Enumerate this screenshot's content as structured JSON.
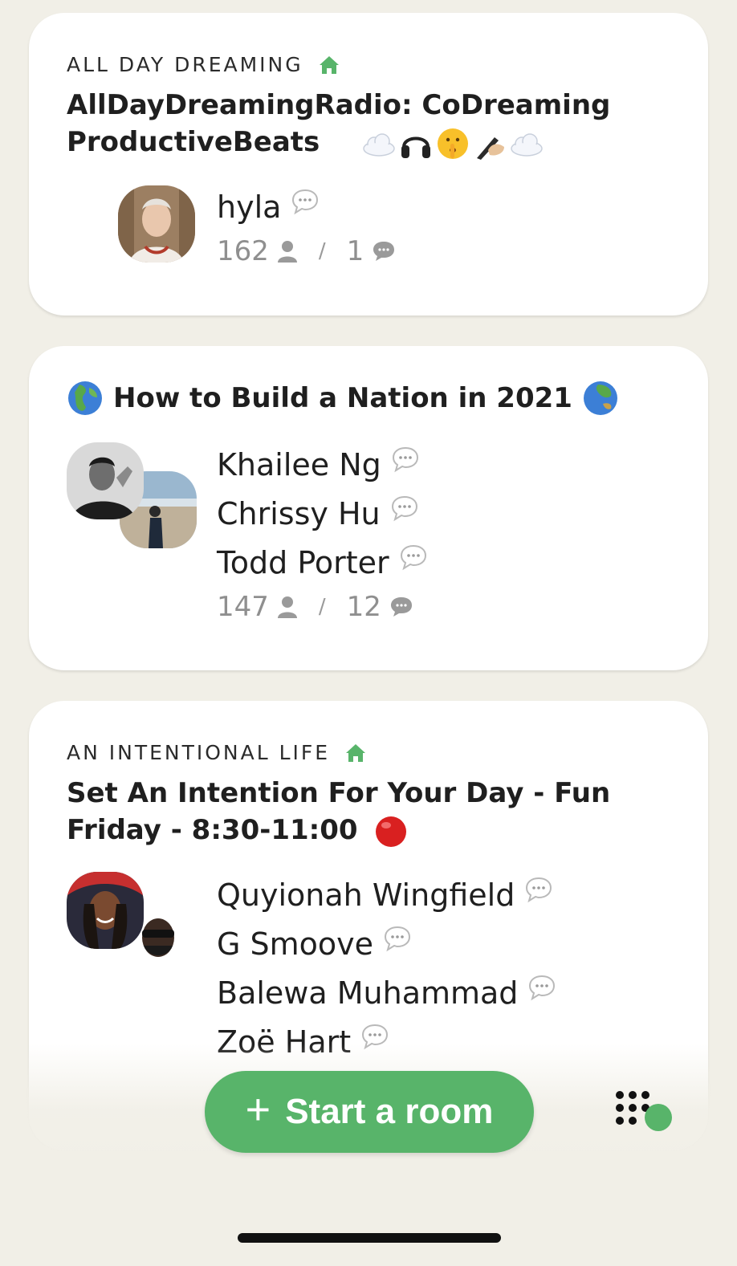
{
  "rooms": [
    {
      "club": "ALL DAY DREAMING",
      "title": "AllDayDreamingRadio: CoDreaming ProductiveBeats",
      "title_emoji": [
        "cloud",
        "headphones",
        "shushing-face",
        "writing-hand",
        "cloud"
      ],
      "speakers": [
        "hyla"
      ],
      "listeners": "162",
      "speaker_count": "1"
    },
    {
      "club": "",
      "title": "How to Build a Nation in 2021",
      "title_emoji": [
        "globe-europe-africa",
        "globe-asia-australia"
      ],
      "speakers": [
        "Khailee Ng",
        "Chrissy Hu",
        "Todd Porter"
      ],
      "listeners": "147",
      "speaker_count": "12"
    },
    {
      "club": "AN INTENTIONAL LIFE",
      "title": "Set An Intention For Your Day - Fun Friday - 8:30-11:00",
      "title_emoji": [
        "red-circle"
      ],
      "speakers": [
        "Quyionah Wingfield",
        "G Smoove",
        "Balewa Muhammad",
        "Zoë Hart"
      ],
      "listeners": "",
      "speaker_count": ""
    }
  ],
  "start_room": {
    "label": "Start a room",
    "icon": "plus-icon"
  },
  "colors": {
    "accent": "#58b46a",
    "background": "#f1efe7",
    "card": "#ffffff"
  }
}
